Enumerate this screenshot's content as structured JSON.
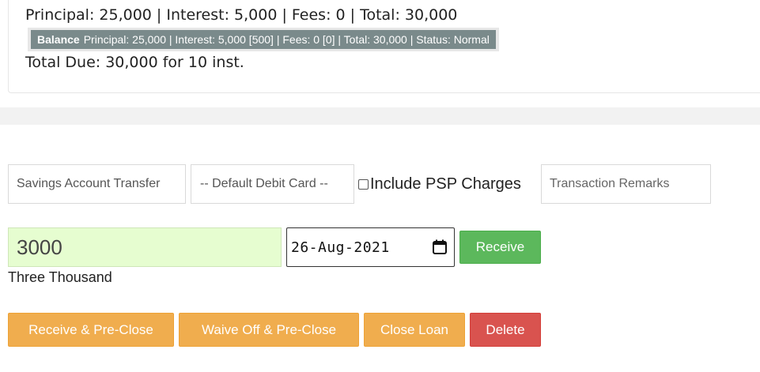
{
  "loan_summary": {
    "cut_line": "— — — — — — — — — — — — — — — — — — — —",
    "principal_line": "Principal: 25,000 | Interest: 5,000 | Fees: 0 | Total: 30,000",
    "balance_label": "Balance",
    "balance_text": "Principal: 25,000 | Interest: 5,000 [500] | Fees: 0 [0] | Total: 30,000 | Status: Normal",
    "total_due": "Total Due: 30,000 for 10 inst."
  },
  "payment_form": {
    "payment_mode": "Savings Account Transfer",
    "debit_card": "-- Default Debit Card --",
    "psp_label": "Include PSP Charges",
    "psp_checked": false,
    "remarks_placeholder": "Transaction Remarks",
    "amount": "3000",
    "amount_words": "Three Thousand",
    "date": "26-Aug-2021",
    "receive_label": "Receive"
  },
  "actions": {
    "receive_preclose": "Receive & Pre-Close",
    "waive_preclose": "Waive Off & Pre-Close",
    "close_loan": "Close Loan",
    "delete": "Delete"
  },
  "colors": {
    "green": "#5cb85c",
    "orange": "#f0ad4e",
    "red": "#d9534f",
    "amount_bg": "#e6fdd0",
    "balance_bg": "#7a8a8b"
  }
}
